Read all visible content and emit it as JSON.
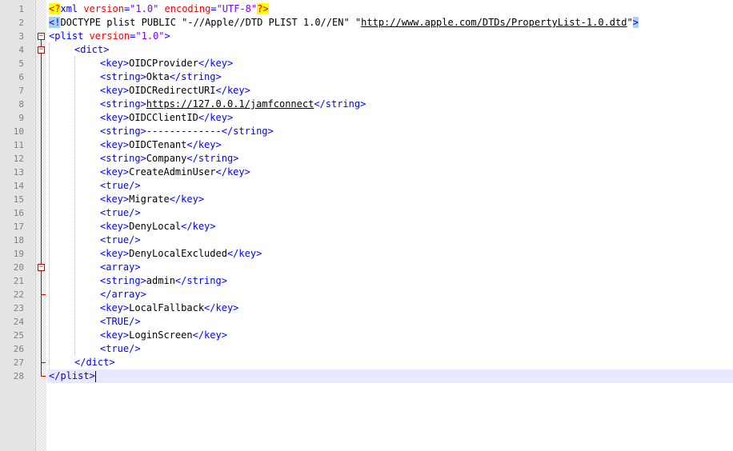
{
  "colors": {
    "tag": "#0000ff",
    "attribute": "#ff0000",
    "attribute_value": "#8000ff",
    "text": "#000000",
    "processing_instruction_highlight": "#ffff00",
    "doctype_highlight": "#a8d0f0",
    "fold_marker": "#cc0000",
    "current_line": "#e8e8ff"
  },
  "current_line": 28,
  "lines": [
    {
      "n": "1",
      "level": 0,
      "parts": [
        [
          "pi",
          "<?"
        ],
        [
          "t",
          "xml"
        ],
        [
          "attr",
          " version"
        ],
        [
          "t",
          "="
        ],
        [
          "val",
          "\"1.0\""
        ],
        [
          "attr",
          " encoding"
        ],
        [
          "t",
          "="
        ],
        [
          "val",
          "\"UTF-8\""
        ],
        [
          "pi",
          "?>"
        ]
      ]
    },
    {
      "n": "2",
      "level": 0,
      "parts": [
        [
          "doc",
          "<!"
        ],
        [
          "doct",
          "DOCTYPE plist PUBLIC \"-//Apple//DTD PLIST 1.0//EN\" \""
        ],
        [
          "url",
          "http://www.apple.com/DTDs/PropertyList-1.0.dtd"
        ],
        [
          "doct",
          "\""
        ],
        [
          "doc",
          ">"
        ]
      ]
    },
    {
      "n": "3",
      "level": 0,
      "parts": [
        [
          "t",
          "<plist"
        ],
        [
          "attr",
          " version"
        ],
        [
          "t",
          "="
        ],
        [
          "val",
          "\"1.0\""
        ],
        [
          "t",
          ">"
        ]
      ]
    },
    {
      "n": "4",
      "level": 1,
      "parts": [
        [
          "t",
          "<dict>"
        ]
      ]
    },
    {
      "n": "5",
      "level": 2,
      "parts": [
        [
          "t",
          "<key>"
        ],
        [
          "txt",
          "OIDCProvider"
        ],
        [
          "t",
          "</key>"
        ]
      ]
    },
    {
      "n": "6",
      "level": 2,
      "parts": [
        [
          "t",
          "<string>"
        ],
        [
          "txt",
          "Okta"
        ],
        [
          "t",
          "</string>"
        ]
      ]
    },
    {
      "n": "7",
      "level": 2,
      "parts": [
        [
          "t",
          "<key>"
        ],
        [
          "txt",
          "OIDCRedirectURI"
        ],
        [
          "t",
          "</key>"
        ]
      ]
    },
    {
      "n": "8",
      "level": 2,
      "parts": [
        [
          "t",
          "<string>"
        ],
        [
          "url",
          "https://127.0.0.1/jamfconnect"
        ],
        [
          "t",
          "</string>"
        ]
      ]
    },
    {
      "n": "9",
      "level": 2,
      "parts": [
        [
          "t",
          "<key>"
        ],
        [
          "txt",
          "OIDCClientID"
        ],
        [
          "t",
          "</key>"
        ]
      ]
    },
    {
      "n": "10",
      "level": 2,
      "parts": [
        [
          "t",
          "<string>"
        ],
        [
          "txt",
          "-------------"
        ],
        [
          "t",
          "</string>"
        ]
      ]
    },
    {
      "n": "11",
      "level": 2,
      "parts": [
        [
          "t",
          "<key>"
        ],
        [
          "txt",
          "OIDCTenant"
        ],
        [
          "t",
          "</key>"
        ]
      ]
    },
    {
      "n": "12",
      "level": 2,
      "parts": [
        [
          "t",
          "<string>"
        ],
        [
          "txt",
          "Company"
        ],
        [
          "t",
          "</string>"
        ]
      ]
    },
    {
      "n": "13",
      "level": 2,
      "parts": [
        [
          "t",
          "<key>"
        ],
        [
          "txt",
          "CreateAdminUser"
        ],
        [
          "t",
          "</key>"
        ]
      ]
    },
    {
      "n": "14",
      "level": 2,
      "parts": [
        [
          "t",
          "<true/>"
        ]
      ]
    },
    {
      "n": "15",
      "level": 2,
      "parts": [
        [
          "t",
          "<key>"
        ],
        [
          "txt",
          "Migrate"
        ],
        [
          "t",
          "</key>"
        ]
      ]
    },
    {
      "n": "16",
      "level": 2,
      "parts": [
        [
          "t",
          "<true/>"
        ]
      ]
    },
    {
      "n": "17",
      "level": 2,
      "parts": [
        [
          "t",
          "<key>"
        ],
        [
          "txt",
          "DenyLocal"
        ],
        [
          "t",
          "</key>"
        ]
      ]
    },
    {
      "n": "18",
      "level": 2,
      "parts": [
        [
          "t",
          "<true/>"
        ]
      ]
    },
    {
      "n": "19",
      "level": 2,
      "parts": [
        [
          "t",
          "<key>"
        ],
        [
          "txt",
          "DenyLocalExcluded"
        ],
        [
          "t",
          "</key>"
        ]
      ]
    },
    {
      "n": "20",
      "level": 2,
      "parts": [
        [
          "t",
          "<array>"
        ]
      ]
    },
    {
      "n": "21",
      "level": 2,
      "parts": [
        [
          "t",
          "<string>"
        ],
        [
          "txt",
          "admin"
        ],
        [
          "t",
          "</string>"
        ]
      ]
    },
    {
      "n": "22",
      "level": 2,
      "parts": [
        [
          "t",
          "</array>"
        ]
      ]
    },
    {
      "n": "23",
      "level": 2,
      "parts": [
        [
          "t",
          "<key>"
        ],
        [
          "txt",
          "LocalFallback"
        ],
        [
          "t",
          "</key>"
        ]
      ]
    },
    {
      "n": "24",
      "level": 2,
      "parts": [
        [
          "t",
          "<TRUE/>"
        ]
      ]
    },
    {
      "n": "25",
      "level": 2,
      "parts": [
        [
          "t",
          "<key>"
        ],
        [
          "txt",
          "LoginScreen"
        ],
        [
          "t",
          "</key>"
        ]
      ]
    },
    {
      "n": "26",
      "level": 2,
      "parts": [
        [
          "t",
          "<true/>"
        ]
      ]
    },
    {
      "n": "27",
      "level": 1,
      "parts": [
        [
          "t",
          "</dict>"
        ]
      ]
    },
    {
      "n": "28",
      "level": 0,
      "parts": [
        [
          "t",
          "</plist>"
        ]
      ]
    }
  ],
  "folds": [
    {
      "start": "3",
      "end": "28",
      "marker": "−"
    },
    {
      "start": "4",
      "end": "27",
      "marker": "−"
    },
    {
      "start": "20",
      "end": "22",
      "marker": "−"
    }
  ]
}
